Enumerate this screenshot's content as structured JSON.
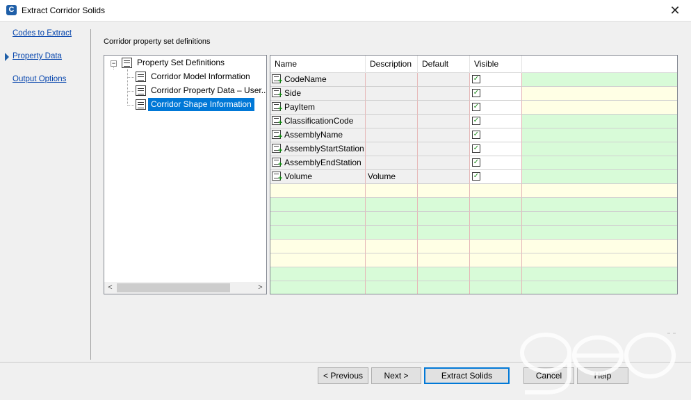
{
  "window": {
    "title": "Extract Corridor Solids",
    "app_icon": "C"
  },
  "nav": {
    "items": [
      {
        "label": "Codes to Extract",
        "active": false
      },
      {
        "label": "Property Data",
        "active": true
      },
      {
        "label": "Output Options",
        "active": false
      }
    ]
  },
  "section_label": "Corridor property set definitions",
  "tree": {
    "root": {
      "label": "Property Set Definitions",
      "expander": "−"
    },
    "children": [
      {
        "label": "Corridor Model Information",
        "selected": false
      },
      {
        "label": "Corridor Property Data – User...",
        "selected": false
      },
      {
        "label": "Corridor Shape Information",
        "selected": true
      }
    ],
    "scroll_left": "<",
    "scroll_right": ">"
  },
  "grid": {
    "headers": {
      "name": "Name",
      "description": "Description",
      "default": "Default",
      "visible": "Visible"
    },
    "rows": [
      {
        "name": "CodeName",
        "description": "",
        "default": "",
        "visible": true
      },
      {
        "name": "Side",
        "description": "",
        "default": "",
        "visible": true
      },
      {
        "name": "PayItem",
        "description": "",
        "default": "",
        "visible": true
      },
      {
        "name": "ClassificationCode",
        "description": "",
        "default": "",
        "visible": true
      },
      {
        "name": "AssemblyName",
        "description": "",
        "default": "",
        "visible": true
      },
      {
        "name": "AssemblyStartStation",
        "description": "",
        "default": "",
        "visible": true
      },
      {
        "name": "AssemblyEndStation",
        "description": "",
        "default": "",
        "visible": true
      },
      {
        "name": "Volume",
        "description": "Volume",
        "default": "",
        "visible": true
      }
    ],
    "colors": {
      "yellow": "#ffffe5",
      "green": "#d8fbd8",
      "row_gray": "#f0f0f0"
    }
  },
  "buttons": {
    "previous": "< Previous",
    "next": "Next >",
    "extract": "Extract Solids",
    "cancel": "Cancel",
    "help": "Help"
  },
  "icons": {
    "close": "✕",
    "check": "✓"
  }
}
